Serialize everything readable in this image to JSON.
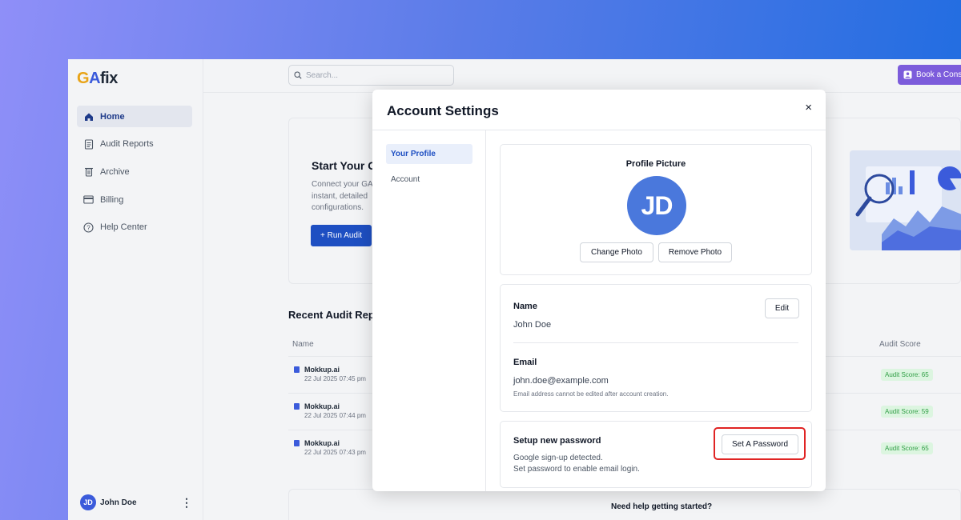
{
  "app": {
    "logo": {
      "g": "G",
      "a": "A",
      "fix": "fix"
    },
    "search_placeholder": "Search...",
    "book_button": "Book a Cons",
    "nav": [
      {
        "label": "Home",
        "icon": "home-icon",
        "active": true
      },
      {
        "label": "Audit Reports",
        "icon": "document-icon",
        "active": false
      },
      {
        "label": "Archive",
        "icon": "trash-icon",
        "active": false
      },
      {
        "label": "Billing",
        "icon": "credit-card-icon",
        "active": false
      },
      {
        "label": "Help Center",
        "icon": "help-circle-icon",
        "active": false
      }
    ],
    "user": {
      "initials": "JD",
      "name": "John Doe"
    }
  },
  "hero": {
    "title": "Start Your G",
    "desc_lines": [
      "Connect your GA",
      "instant, detailed",
      "configurations."
    ],
    "run_button": "+ Run Audit"
  },
  "recent": {
    "title": "Recent Audit Repo",
    "col_name": "Name",
    "col_score": "Audit Score",
    "rows": [
      {
        "name": "Mokkup.ai",
        "date": "22 Jul 2025 07:45 pm",
        "score": "Audit Score: 65"
      },
      {
        "name": "Mokkup.ai",
        "date": "22 Jul 2025 07:44 pm",
        "score": "Audit Score: 59"
      },
      {
        "name": "Mokkup.ai",
        "date": "22 Jul 2025 07:43 pm",
        "score": "Audit Score: 65"
      }
    ]
  },
  "help_text": "Need help getting started?",
  "modal": {
    "title": "Account Settings",
    "close": "×",
    "nav": [
      {
        "label": "Your Profile",
        "active": true
      },
      {
        "label": "Account",
        "active": false
      }
    ],
    "profile_picture": {
      "title": "Profile Picture",
      "initials": "JD",
      "change_button": "Change Photo",
      "remove_button": "Remove Photo"
    },
    "name": {
      "label": "Name",
      "value": "John Doe",
      "edit_button": "Edit"
    },
    "email": {
      "label": "Email",
      "value": "john.doe@example.com",
      "note": "Email address cannot be edited after account creation."
    },
    "password": {
      "title": "Setup new password",
      "desc_line1": "Google sign-up detected.",
      "desc_line2": "Set password to enable email login.",
      "button": "Set A Password"
    }
  },
  "colors": {
    "accent": "#1e4fc2",
    "avatar": "#4a78dc",
    "highlight": "#e02424",
    "book_button": "#7c5cdb",
    "score_badge_bg": "#dcf5e0",
    "score_badge_text": "#2f9e44"
  }
}
